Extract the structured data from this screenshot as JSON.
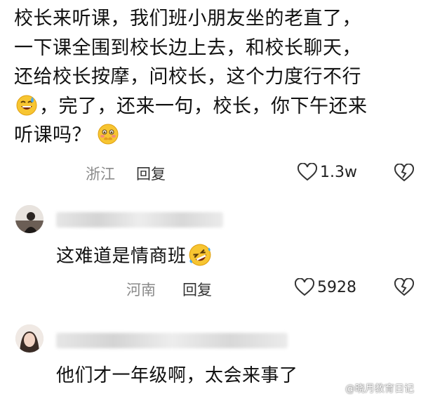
{
  "main_comment": {
    "lines": [
      "校长来听课，我们班小朋友坐的老直了，",
      "一下课全围到校长边上去，和校长聊天，",
      "还给校长按摩，问校长，这个力度行不行",
      "，完了，还来一句，校长，你下午还来",
      "听课吗？"
    ],
    "location": "浙江",
    "reply_label": "回复",
    "like_count": "1.3w"
  },
  "replies": [
    {
      "text": "这难道是情商班",
      "location": "河南",
      "reply_label": "回复",
      "like_count": "5928"
    },
    {
      "text": "他们才一年级啊，太会来事了"
    }
  ],
  "watermark": "@晓月教育日记",
  "icons": {
    "like": "heart-outline-icon",
    "dislike": "broken-heart-icon",
    "emoji_sweat": "sweat-smile-emoji-icon",
    "emoji_shy": "shy-face-emoji-icon",
    "emoji_laugh": "rolling-laugh-emoji-icon"
  }
}
